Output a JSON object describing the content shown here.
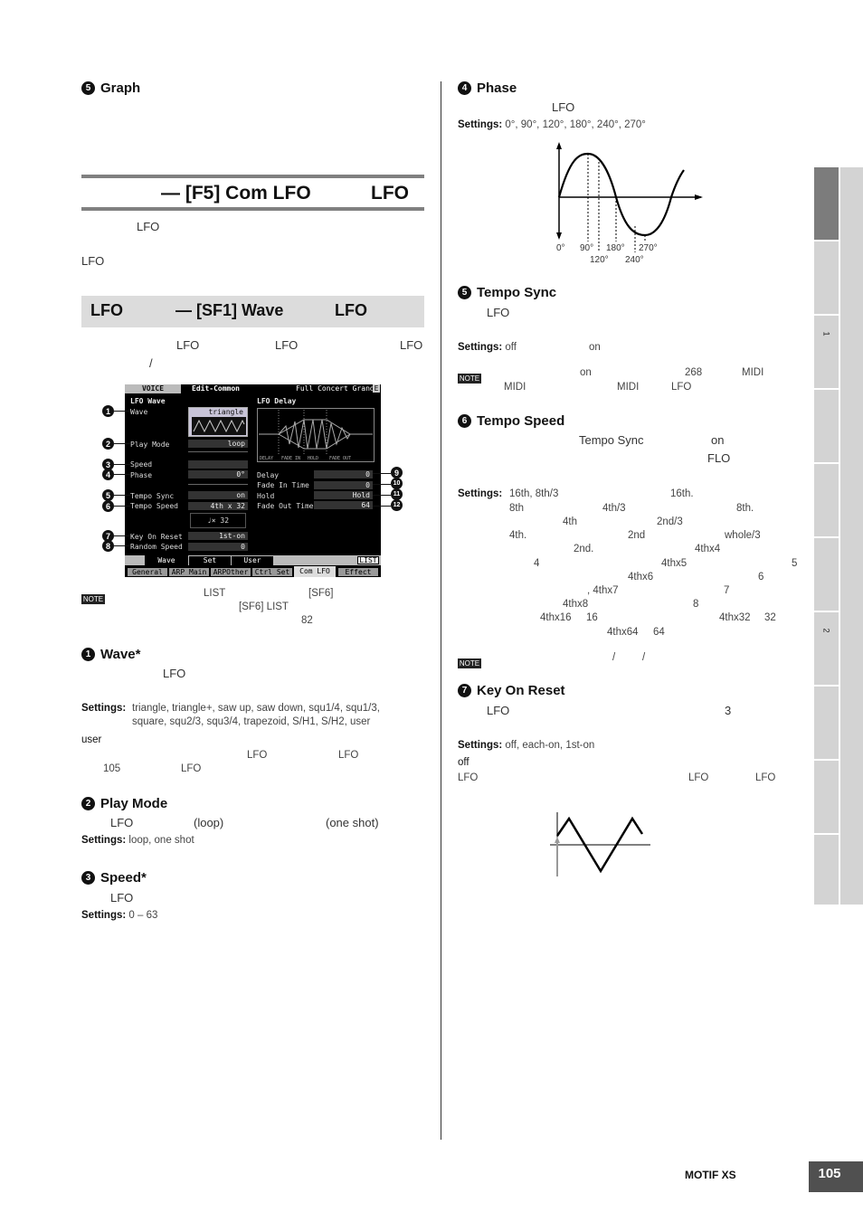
{
  "left": {
    "graph_heading": {
      "num": "5",
      "label": "Graph"
    },
    "f5_bar": {
      "title": "— [F5] Com LFO",
      "suffix": "LFO"
    },
    "f5_intro": {
      "line1": "LFO",
      "line2": "LFO"
    },
    "sf1_bar": {
      "prefix": "LFO",
      "title": "— [SF1] Wave",
      "suffix": "LFO"
    },
    "sf1_intro": {
      "lfo1": "LFO",
      "lfo2": "LFO",
      "lfo3": "LFO",
      "slash": "/"
    },
    "lcd": {
      "mode": "VOICE",
      "screen": "Edit-Common",
      "voice_name": "Full Concert Grand",
      "menu_icon": "E",
      "left_title": "LFO Wave",
      "right_title": "LFO Delay",
      "params_left": [
        {
          "label": "Wave",
          "value": "triangle"
        },
        {
          "label": "Play Mode",
          "value": "loop"
        },
        {
          "label": "Speed",
          "value": ""
        },
        {
          "label": "Phase",
          "value": "0°"
        },
        {
          "label": "Tempo Sync",
          "value": "on"
        },
        {
          "label": "Tempo Speed",
          "value": "4th x 32"
        },
        {
          "label": "Key On Reset",
          "value": "1st-on"
        },
        {
          "label": "Random Speed",
          "value": "0"
        }
      ],
      "tempo_note": "♩× 32",
      "params_right": [
        {
          "label": "Delay",
          "value": "0"
        },
        {
          "label": "Fade In Time",
          "value": "0"
        },
        {
          "label": "Hold",
          "value": "Hold"
        },
        {
          "label": "Fade Out Time",
          "value": "64"
        }
      ],
      "delay_graph_labels": [
        "DELAY",
        "FADE IN",
        "HOLD",
        "FADE OUT"
      ],
      "sub_tabs": [
        "Wave",
        "Set",
        "User"
      ],
      "list_button": "LIST",
      "main_tabs": [
        "General",
        "ARP Main",
        "ARPOther",
        "Ctrl Set",
        "Com LFO",
        "Effect"
      ],
      "active_main_tab": "Com LFO",
      "callouts": [
        "1",
        "2",
        "3",
        "4",
        "5",
        "6",
        "7",
        "8",
        "9",
        "10",
        "11",
        "12"
      ]
    },
    "note1": {
      "icon": "NOTE",
      "t1": "LIST",
      "t2": "[SF6]",
      "t3": "[SF6] LIST",
      "t4": "82"
    },
    "wave": {
      "num": "1",
      "label": "Wave*",
      "desc": "LFO",
      "settings_label": "Settings:",
      "settings": "triangle, triangle+, saw up, saw down, squ1/4, squ1/3,",
      "settings2": "square, squ2/3, squ3/4, trapezoid, S/H1, S/H2, user",
      "user": "user",
      "lfo_a": "LFO",
      "lfo_b": "LFO",
      "p105": "105",
      "lfo_c": "LFO"
    },
    "play_mode": {
      "num": "2",
      "label": "Play Mode",
      "lfo": "LFO",
      "loop": "(loop)",
      "one_shot": "(one shot)",
      "settings_label": "Settings:",
      "settings": "loop, one shot"
    },
    "speed": {
      "num": "3",
      "label": "Speed*",
      "desc": "LFO",
      "settings_label": "Settings:",
      "settings": "0 – 63"
    }
  },
  "right": {
    "phase": {
      "num": "4",
      "label": "Phase",
      "desc": "LFO",
      "settings_label": "Settings:",
      "settings": "0°, 90°, 120°, 180°, 240°, 270°",
      "diagram_labels": [
        "0°",
        "90°",
        "180°",
        "270°",
        "120°",
        "240°"
      ]
    },
    "tempo_sync": {
      "num": "5",
      "label": "Tempo Sync",
      "desc": "LFO",
      "settings_label": "Settings:",
      "off": "off",
      "on": "on",
      "note": {
        "icon": "NOTE",
        "on": "on",
        "p268": "268",
        "midi1": "MIDI",
        "midi2": "MIDI",
        "midi3": "MIDI",
        "lfo": "LFO"
      }
    },
    "tempo_speed": {
      "num": "6",
      "label": "Tempo Speed",
      "ts": "Tempo Sync",
      "on": "on",
      "flo": "FLO",
      "settings_label": "Settings:",
      "lines": [
        [
          "16th, 8th/3",
          "16th."
        ],
        [
          "8th",
          "4th/3",
          "8th."
        ],
        [
          "4th",
          "2nd/3"
        ],
        [
          "4th.",
          "2nd",
          "whole/3"
        ],
        [
          "2nd.",
          "4thx4"
        ],
        [
          "4",
          "4thx5",
          "5"
        ],
        [
          "4thx6",
          "6"
        ],
        [
          ", 4thx7",
          "7"
        ],
        [
          "4thx8",
          "8"
        ],
        [
          "4thx16",
          "16",
          "4thx32",
          "32"
        ],
        [
          "4thx64",
          "64"
        ]
      ],
      "note": {
        "icon": "NOTE",
        "s1": "/",
        "s2": "/"
      }
    },
    "key_on_reset": {
      "num": "7",
      "label": "Key On Reset",
      "desc": "LFO",
      "three": "3",
      "settings_label": "Settings:",
      "settings": "off, each-on, 1st-on",
      "off": "off",
      "lfo1": "LFO",
      "lfo2": "LFO",
      "lfo3": "LFO"
    }
  },
  "side_tabs": {
    "labels": [
      "",
      "",
      "1",
      "",
      "",
      "",
      "2",
      "",
      "",
      ""
    ],
    "active_index": 0
  },
  "footer": {
    "product": "MOTIF XS",
    "page": "105"
  }
}
